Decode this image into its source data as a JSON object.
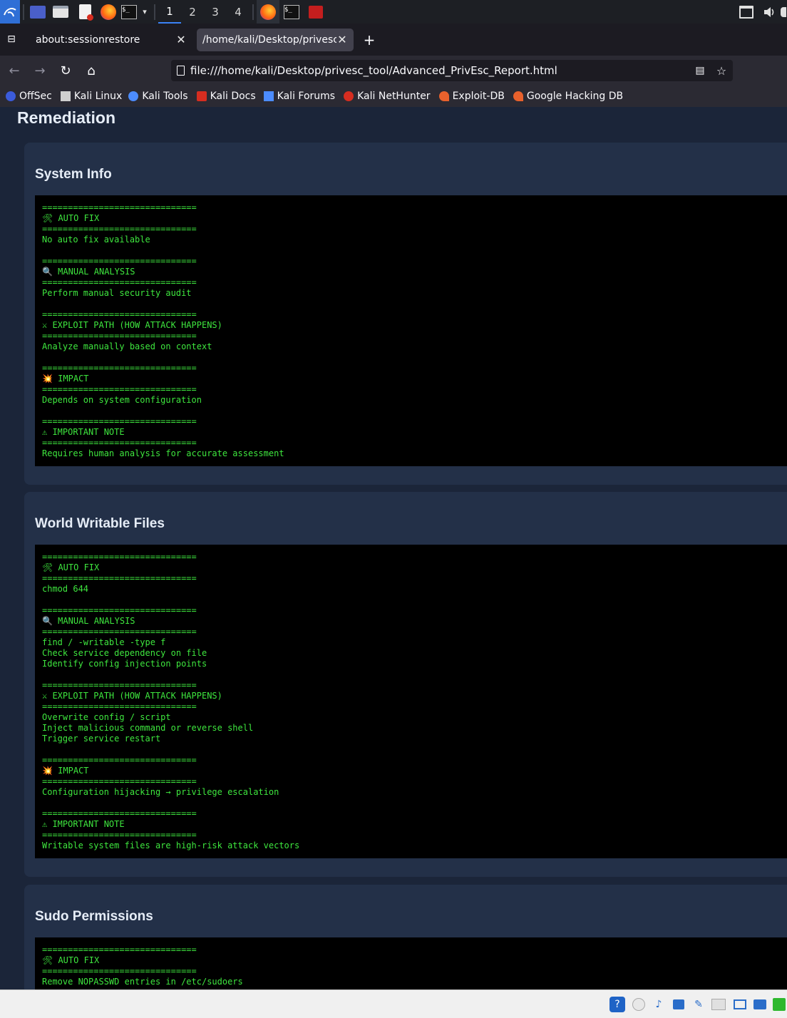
{
  "taskbar": {
    "workspaces": [
      "1",
      "2",
      "3",
      "4"
    ],
    "active_workspace": "1"
  },
  "tabs": [
    {
      "title": "about:sessionrestore",
      "active": false
    },
    {
      "title": "/home/kali/Desktop/privesc_",
      "active": true
    }
  ],
  "navbar": {
    "url": "file:///home/kali/Desktop/privesc_tool/Advanced_PrivEsc_Report.html"
  },
  "bookmarks": [
    {
      "label": "OffSec",
      "color": "#3b5bdb"
    },
    {
      "label": "Kali Linux",
      "color": "#cfcfcf"
    },
    {
      "label": "Kali Tools",
      "color": "#4c8cff"
    },
    {
      "label": "Kali Docs",
      "color": "#d62d20"
    },
    {
      "label": "Kali Forums",
      "color": "#4c8cff"
    },
    {
      "label": "Kali NetHunter",
      "color": "#d62d20"
    },
    {
      "label": "Exploit-DB",
      "color": "#e8612c"
    },
    {
      "label": "Google Hacking DB",
      "color": "#e8612c"
    }
  ],
  "page": {
    "heading": "Remediation",
    "sections": [
      {
        "title": "System Info",
        "lines": [
          "==============================",
          "🛠 AUTO FIX",
          "==============================",
          "No auto fix available",
          "",
          "==============================",
          "🔍 MANUAL ANALYSIS",
          "==============================",
          "Perform manual security audit",
          "",
          "==============================",
          "⚔ EXPLOIT PATH (HOW ATTACK HAPPENS)",
          "==============================",
          "Analyze manually based on context",
          "",
          "==============================",
          "💥 IMPACT",
          "==============================",
          "Depends on system configuration",
          "",
          "==============================",
          "⚠ IMPORTANT NOTE",
          "==============================",
          "Requires human analysis for accurate assessment"
        ]
      },
      {
        "title": "World Writable Files",
        "lines": [
          "==============================",
          "🛠 AUTO FIX",
          "==============================",
          "chmod 644",
          "",
          "==============================",
          "🔍 MANUAL ANALYSIS",
          "==============================",
          "find / -writable -type f",
          "Check service dependency on file",
          "Identify config injection points",
          "",
          "==============================",
          "⚔ EXPLOIT PATH (HOW ATTACK HAPPENS)",
          "==============================",
          "Overwrite config / script",
          "Inject malicious command or reverse shell",
          "Trigger service restart",
          "",
          "==============================",
          "💥 IMPACT",
          "==============================",
          "Configuration hijacking → privilege escalation",
          "",
          "==============================",
          "⚠ IMPORTANT NOTE",
          "==============================",
          "Writable system files are high-risk attack vectors"
        ]
      },
      {
        "title": "Sudo Permissions",
        "lines": [
          "==============================",
          "🛠 AUTO FIX",
          "==============================",
          "Remove NOPASSWD entries in /etc/sudoers"
        ]
      }
    ]
  }
}
